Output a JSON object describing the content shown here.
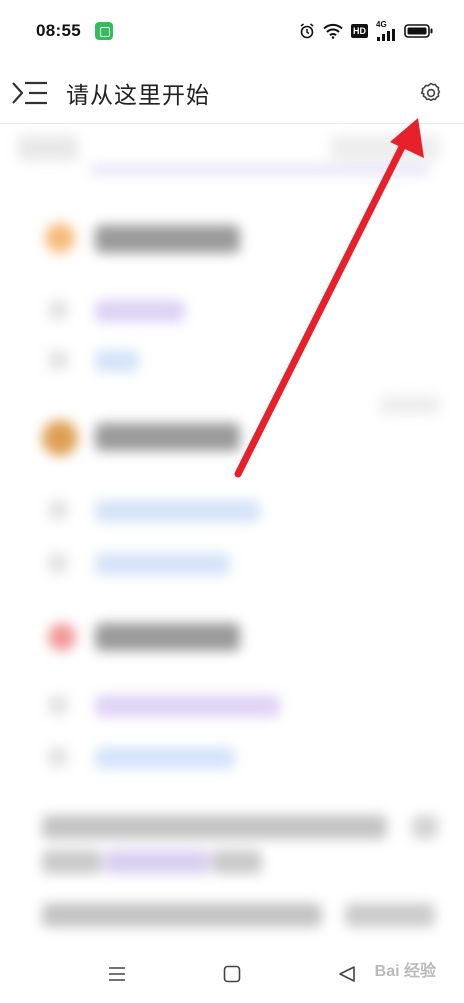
{
  "status_bar": {
    "time": "08:55",
    "hd_label": "HD",
    "network_label": "4G"
  },
  "header": {
    "title": "请从这里开始",
    "menu_icon": "menu-collapse-icon",
    "settings_icon": "gear-icon"
  },
  "nav_bar": {
    "menu_icon": "hamburger-icon",
    "home_icon": "square-home-icon",
    "back_icon": "triangle-back-icon"
  },
  "watermark": {
    "text": "Bai 经验"
  },
  "colors": {
    "annotation_arrow": "#e8202a",
    "divider": "#e6e6e6",
    "status_app_icon": "#2fbf5b"
  }
}
